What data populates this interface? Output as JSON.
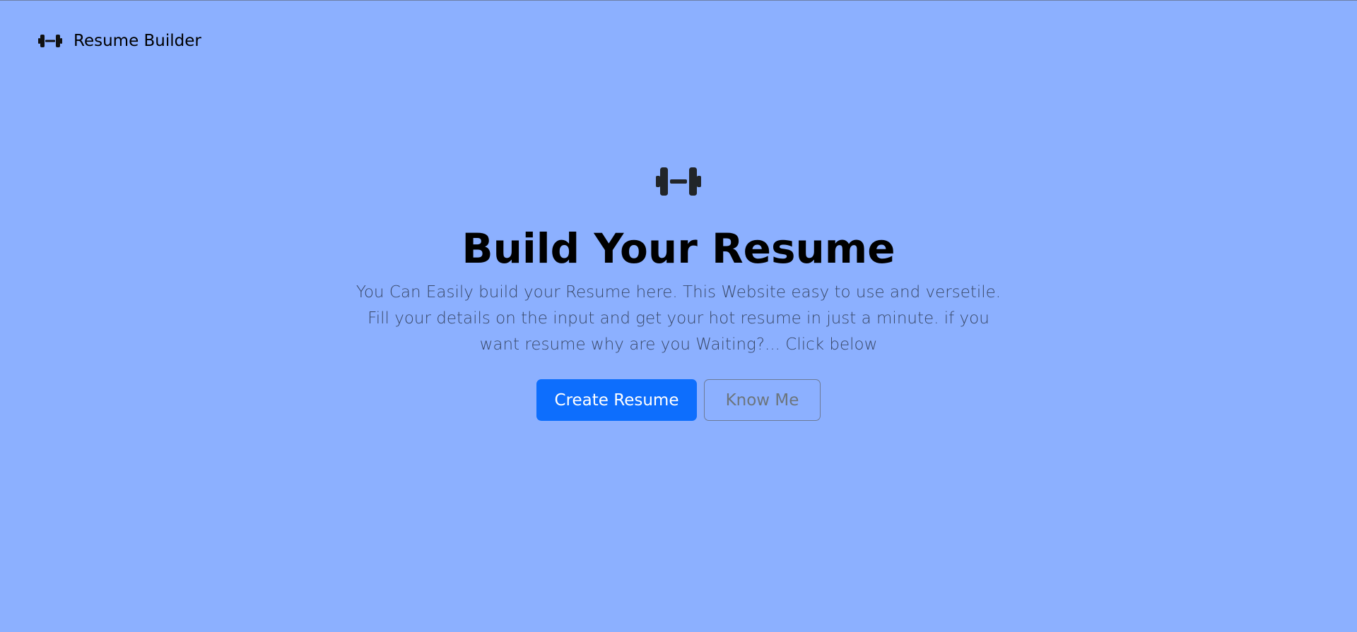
{
  "navbar": {
    "brand_icon": "dumbbell-icon",
    "brand_label": "Resume Builder"
  },
  "hero": {
    "icon": "dumbbell-icon",
    "title": "Build Your Resume",
    "description": "You Can Easily build your Resume here. This Website easy to use and versetile. Fill your details on the input and get your hot resume in just a minute. if you want resume why are you Waiting?... Click below",
    "primary_button_label": "Create Resume",
    "secondary_button_label": "Know Me"
  },
  "colors": {
    "background": "#8cb0ff",
    "primary": "#0d6efd",
    "secondary_text": "#6c757d",
    "icon": "#212529"
  }
}
